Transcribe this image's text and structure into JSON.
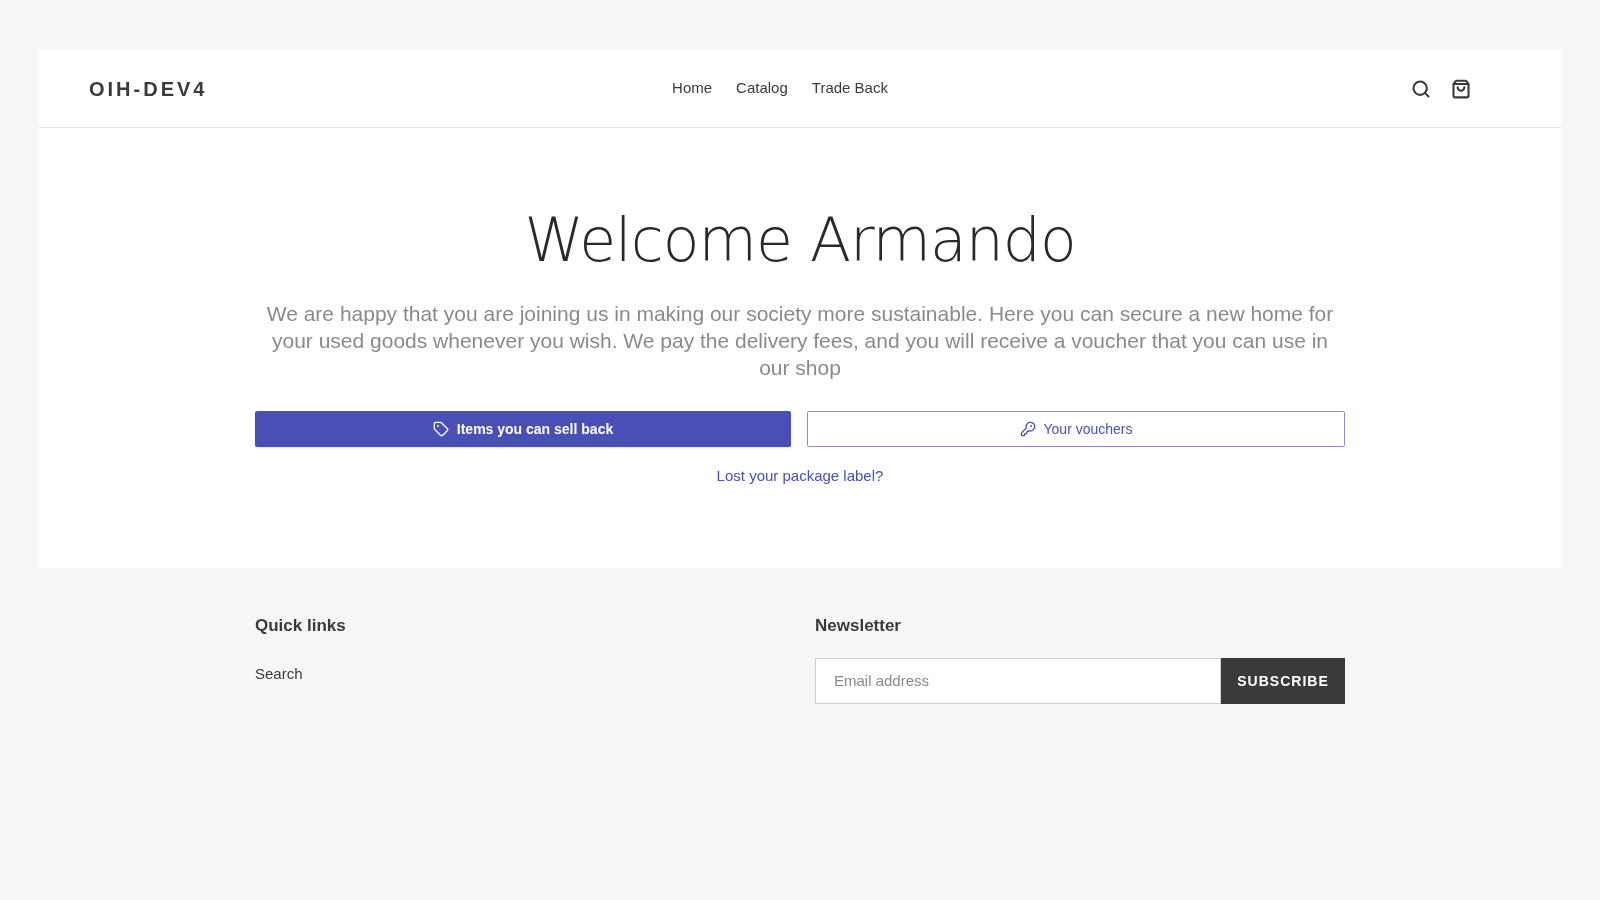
{
  "header": {
    "logo": "OIH-DEV4",
    "nav": [
      {
        "label": "Home"
      },
      {
        "label": "Catalog"
      },
      {
        "label": "Trade Back"
      }
    ]
  },
  "hero": {
    "title": "Welcome Armando",
    "text": "We are happy that you are joining us in making our society more sustainable. Here you can secure a new home for your used goods whenever you wish. We pay the delivery fees, and you will receive a voucher that you can use in our shop",
    "buttons": [
      {
        "label": "Items you can sell back",
        "kind": "primary"
      },
      {
        "label": "Your vouchers",
        "kind": "outline"
      }
    ],
    "link": "Lost your package label?"
  },
  "footer": {
    "quick_links": {
      "title": "Quick links",
      "items": [
        "Search"
      ]
    },
    "newsletter": {
      "title": "Newsletter",
      "placeholder": "Email address",
      "button": "SUBSCRIBE"
    }
  }
}
